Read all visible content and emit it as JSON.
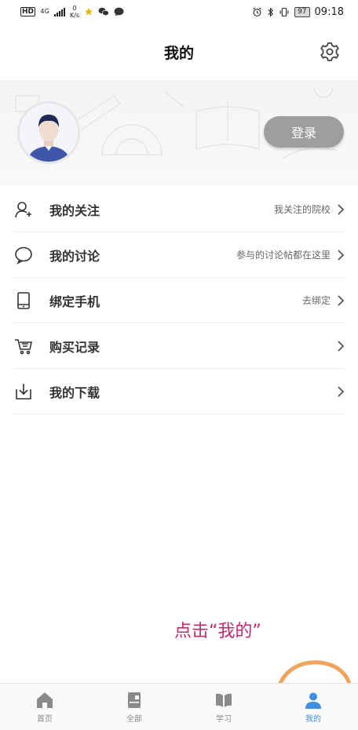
{
  "status_bar": {
    "hd": "HD",
    "network": "4G",
    "speed_value": "0",
    "speed_unit": "K/s",
    "battery": "97",
    "time": "09:18"
  },
  "header": {
    "title": "我的",
    "settings_icon": "gear-icon"
  },
  "profile": {
    "login_label": "登录",
    "avatar_icon": "user-avatar"
  },
  "menu": [
    {
      "label": "我的关注",
      "hint": "我关注的院校",
      "icon": "user-follow-icon"
    },
    {
      "label": "我的讨论",
      "hint": "参与的讨论帖都在这里",
      "icon": "chat-bubble-icon"
    },
    {
      "label": "绑定手机",
      "hint": "去绑定",
      "icon": "phone-icon"
    },
    {
      "label": "购买记录",
      "hint": "",
      "icon": "cart-icon"
    },
    {
      "label": "我的下载",
      "hint": "",
      "icon": "download-icon"
    }
  ],
  "annotation": {
    "text": "点击“我的”",
    "color": "#c5296c"
  },
  "tabbar": {
    "tabs": [
      {
        "label": "首页",
        "icon": "home-icon",
        "active": false
      },
      {
        "label": "全部",
        "icon": "book-grid-icon",
        "active": false
      },
      {
        "label": "学习",
        "icon": "open-book-icon",
        "active": false
      },
      {
        "label": "我的",
        "icon": "person-icon",
        "active": true
      }
    ],
    "active_color": "#3f8fe6",
    "inactive_color": "#8a8a8a"
  }
}
